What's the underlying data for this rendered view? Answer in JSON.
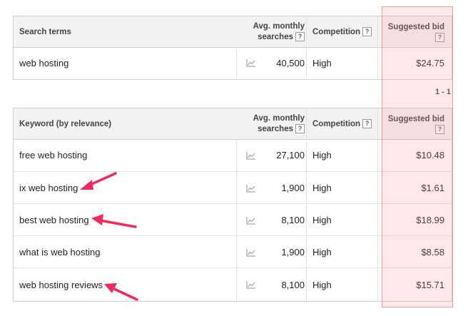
{
  "search_table": {
    "headers": {
      "term": "Search terms",
      "searches_line1": "Avg. monthly",
      "searches_line2": "searches",
      "competition": "Competition",
      "bid": "Suggested bid",
      "help": "?"
    },
    "rows": [
      {
        "term": "web hosting",
        "searches": "40,500",
        "competition": "High",
        "bid": "$24.75"
      }
    ]
  },
  "pager": {
    "label": "1 - 1"
  },
  "keyword_table": {
    "headers": {
      "term": "Keyword (by relevance)",
      "searches_line1": "Avg. monthly",
      "searches_line2": "searches",
      "competition": "Competition",
      "bid": "Suggested bid",
      "help": "?"
    },
    "rows": [
      {
        "term": "free web hosting",
        "searches": "27,100",
        "competition": "High",
        "bid": "$10.48"
      },
      {
        "term": "ix web hosting",
        "searches": "1,900",
        "competition": "High",
        "bid": "$1.61"
      },
      {
        "term": "best web hosting",
        "searches": "8,100",
        "competition": "High",
        "bid": "$18.99"
      },
      {
        "term": "what is web hosting",
        "searches": "1,900",
        "competition": "High",
        "bid": "$8.58"
      },
      {
        "term": "web hosting reviews",
        "searches": "8,100",
        "competition": "High",
        "bid": "$15.71"
      }
    ]
  },
  "annotations": {
    "highlight_color": "#e85a6e",
    "arrow_color": "#ee2a5e",
    "icon": "trend-chart-icon"
  }
}
